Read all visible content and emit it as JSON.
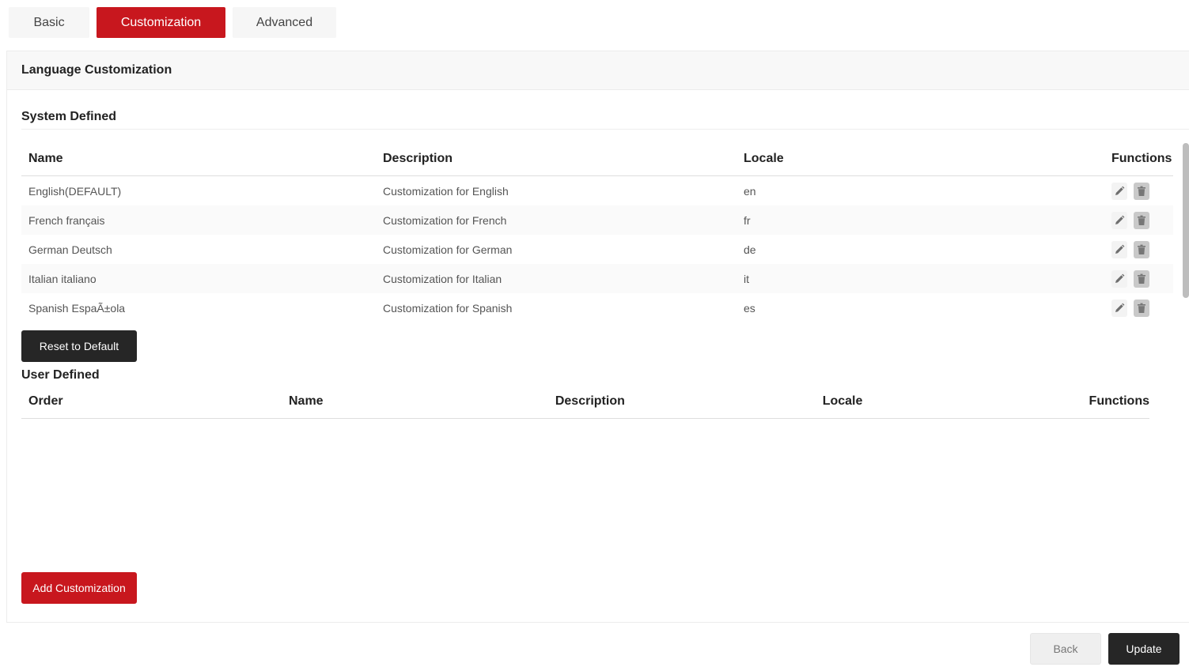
{
  "tabs": [
    {
      "label": "Basic",
      "active": false
    },
    {
      "label": "Customization",
      "active": true
    },
    {
      "label": "Advanced",
      "active": false
    }
  ],
  "panel": {
    "title": "Language Customization"
  },
  "system_defined": {
    "title": "System Defined",
    "columns": [
      "Name",
      "Description",
      "Locale",
      "Functions"
    ],
    "rows": [
      {
        "name": "English(DEFAULT)",
        "description": "Customization for English",
        "locale": "en"
      },
      {
        "name": "French français",
        "description": "Customization for French",
        "locale": "fr"
      },
      {
        "name": "German Deutsch",
        "description": "Customization for German",
        "locale": "de"
      },
      {
        "name": "Italian italiano",
        "description": "Customization for Italian",
        "locale": "it"
      },
      {
        "name": "Spanish EspaÃ±ola",
        "description": "Customization for Spanish",
        "locale": "es"
      }
    ],
    "reset_label": "Reset to Default"
  },
  "user_defined": {
    "title": "User Defined",
    "columns": [
      "Order",
      "Name",
      "Description",
      "Locale",
      "Functions"
    ],
    "add_label": "Add Customization"
  },
  "footer": {
    "back_label": "Back",
    "update_label": "Update"
  },
  "colors": {
    "accent": "#c8171e",
    "dark": "#262626",
    "light_bg": "#f6f6f6"
  },
  "icons": {
    "edit": "pencil-icon",
    "delete": "trash-icon"
  }
}
